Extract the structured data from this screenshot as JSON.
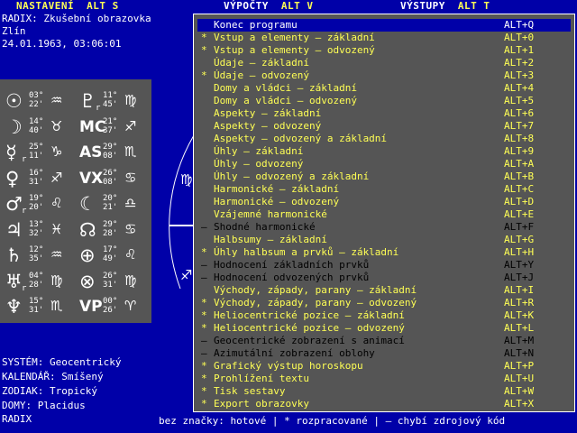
{
  "menu": {
    "items": [
      {
        "label": "NASTAVENÍ",
        "hotkey": "ALT S"
      },
      {
        "label": "VÝPOČTY",
        "hotkey": "ALT V"
      },
      {
        "label": "VÝSTUPY",
        "hotkey": "ALT T"
      }
    ]
  },
  "radix": {
    "title": "RADIX: Zkušební obrazovka",
    "place": "Zlín",
    "datetime": "24.01.1963, 03:06:01"
  },
  "planets_left": [
    {
      "glyph": "☉",
      "deg": "03°",
      "min": "22'",
      "sign": "♒"
    },
    {
      "glyph": "☽",
      "deg": "14°",
      "min": "40'",
      "sign": "♉"
    },
    {
      "glyph": "☿",
      "deg": "25°",
      "min": "11'",
      "sign": "♑",
      "retro": "r"
    },
    {
      "glyph": "♀",
      "deg": "16°",
      "min": "31'",
      "sign": "♐"
    },
    {
      "glyph": "♂",
      "deg": "19°",
      "min": "20'",
      "sign": "♌",
      "retro": "r"
    },
    {
      "glyph": "♃",
      "deg": "13°",
      "min": "32'",
      "sign": "♓"
    },
    {
      "glyph": "♄",
      "deg": "12°",
      "min": "35'",
      "sign": "♒"
    },
    {
      "glyph": "♅",
      "deg": "04°",
      "min": "28'",
      "sign": "♍",
      "retro": "r"
    },
    {
      "glyph": "♆",
      "deg": "15°",
      "min": "31'",
      "sign": "♏"
    }
  ],
  "planets_right": [
    {
      "glyph": "♇",
      "deg": "11°",
      "min": "45'",
      "sign": "♍",
      "retro": "r"
    },
    {
      "glyph": "MC",
      "deg": "21°",
      "min": "37'",
      "sign": "♐"
    },
    {
      "glyph": "AS",
      "deg": "29°",
      "min": "08'",
      "sign": "♏"
    },
    {
      "glyph": "VX",
      "deg": "26°",
      "min": "08'",
      "sign": "♋"
    },
    {
      "glyph": "☾",
      "deg": "20°",
      "min": "21'",
      "sign": "♎"
    },
    {
      "glyph": "☊",
      "deg": "29°",
      "min": "28'",
      "sign": "♋"
    },
    {
      "glyph": "⊕",
      "deg": "17°",
      "min": "49'",
      "sign": "♌"
    },
    {
      "glyph": "⊗",
      "deg": "26°",
      "min": "31'",
      "sign": "♍"
    },
    {
      "glyph": "VP",
      "deg": "00°",
      "min": "26'",
      "sign": "♈"
    }
  ],
  "settings": {
    "system": "SYSTÉM: Geocentrický",
    "calendar": "KALENDÁŘ: Smíšený",
    "zodiac": "ZODIAK: Tropický",
    "houses": "DOMY: Placidus"
  },
  "footer_left": "RADIX",
  "legend": "bez značky: hotové | * rozpracované | – chybí zdrojový kód",
  "dropdown": {
    "items": [
      {
        "mark": "",
        "label": "Konec programu",
        "key": "ALT+Q",
        "state": "selected"
      },
      {
        "mark": "*",
        "label": "Vstup a elementy – základní",
        "key": "ALT+0",
        "state": "done"
      },
      {
        "mark": "*",
        "label": "Vstup a elementy – odvozený",
        "key": "ALT+1",
        "state": "done"
      },
      {
        "mark": "",
        "label": "Údaje – základní",
        "key": "ALT+2",
        "state": "done"
      },
      {
        "mark": "*",
        "label": "Údaje – odvozený",
        "key": "ALT+3",
        "state": "done"
      },
      {
        "mark": "",
        "label": "Domy a vládci – základní",
        "key": "ALT+4",
        "state": "done"
      },
      {
        "mark": "",
        "label": "Domy a vládci – odvozený",
        "key": "ALT+5",
        "state": "done"
      },
      {
        "mark": "",
        "label": "Aspekty – základní",
        "key": "ALT+6",
        "state": "done"
      },
      {
        "mark": "",
        "label": "Aspekty – odvozený",
        "key": "ALT+7",
        "state": "done"
      },
      {
        "mark": "",
        "label": "Aspekty – odvozený a základní",
        "key": "ALT+8",
        "state": "done"
      },
      {
        "mark": "",
        "label": "Úhly – základní",
        "key": "ALT+9",
        "state": "done"
      },
      {
        "mark": "",
        "label": "Úhly – odvozený",
        "key": "ALT+A",
        "state": "done"
      },
      {
        "mark": "",
        "label": "Úhly – odvozený a základní",
        "key": "ALT+B",
        "state": "done"
      },
      {
        "mark": "",
        "label": "Harmonické – základní",
        "key": "ALT+C",
        "state": "done"
      },
      {
        "mark": "",
        "label": "Harmonické – odvozený",
        "key": "ALT+D",
        "state": "done"
      },
      {
        "mark": "",
        "label": "Vzájemné harmonické",
        "key": "ALT+E",
        "state": "done"
      },
      {
        "mark": "–",
        "label": "Shodné harmonické",
        "key": "ALT+F",
        "state": "missing"
      },
      {
        "mark": "",
        "label": "Halbsumy – základní",
        "key": "ALT+G",
        "state": "done"
      },
      {
        "mark": "*",
        "label": "Úhly halbsum a prvků – základní",
        "key": "ALT+H",
        "state": "done"
      },
      {
        "mark": "–",
        "label": "Hodnocení základních prvků",
        "key": "ALT+Y",
        "state": "missing"
      },
      {
        "mark": "–",
        "label": "Hodnocení odvozených prvků",
        "key": "ALT+J",
        "state": "missing"
      },
      {
        "mark": "",
        "label": "Východy, západy, parany – základní",
        "key": "ALT+I",
        "state": "done"
      },
      {
        "mark": "*",
        "label": "Východy, západy, parany – odvozený",
        "key": "ALT+R",
        "state": "done"
      },
      {
        "mark": "*",
        "label": "Heliocentrické pozice – základní",
        "key": "ALT+K",
        "state": "done"
      },
      {
        "mark": "*",
        "label": "Heliocentrické pozice – odvozený",
        "key": "ALT+L",
        "state": "done"
      },
      {
        "mark": "–",
        "label": "Geocentrické zobrazení s animací",
        "key": "ALT+M",
        "state": "missing"
      },
      {
        "mark": "–",
        "label": "Azimutální zobrazení oblohy",
        "key": "ALT+N",
        "state": "missing"
      },
      {
        "mark": "*",
        "label": "Grafický výstup horoskopu",
        "key": "ALT+P",
        "state": "done"
      },
      {
        "mark": "*",
        "label": "Prohlížení textu",
        "key": "ALT+U",
        "state": "done"
      },
      {
        "mark": "*",
        "label": "Tisk sestavy",
        "key": "ALT+W",
        "state": "done"
      },
      {
        "mark": "*",
        "label": "Export obrazovky",
        "key": "ALT+X",
        "state": "done"
      }
    ]
  },
  "colors": {
    "background": "#0000a8",
    "panel": "#555555",
    "highlight_text": "#ffff55",
    "missing_text": "#000000"
  }
}
